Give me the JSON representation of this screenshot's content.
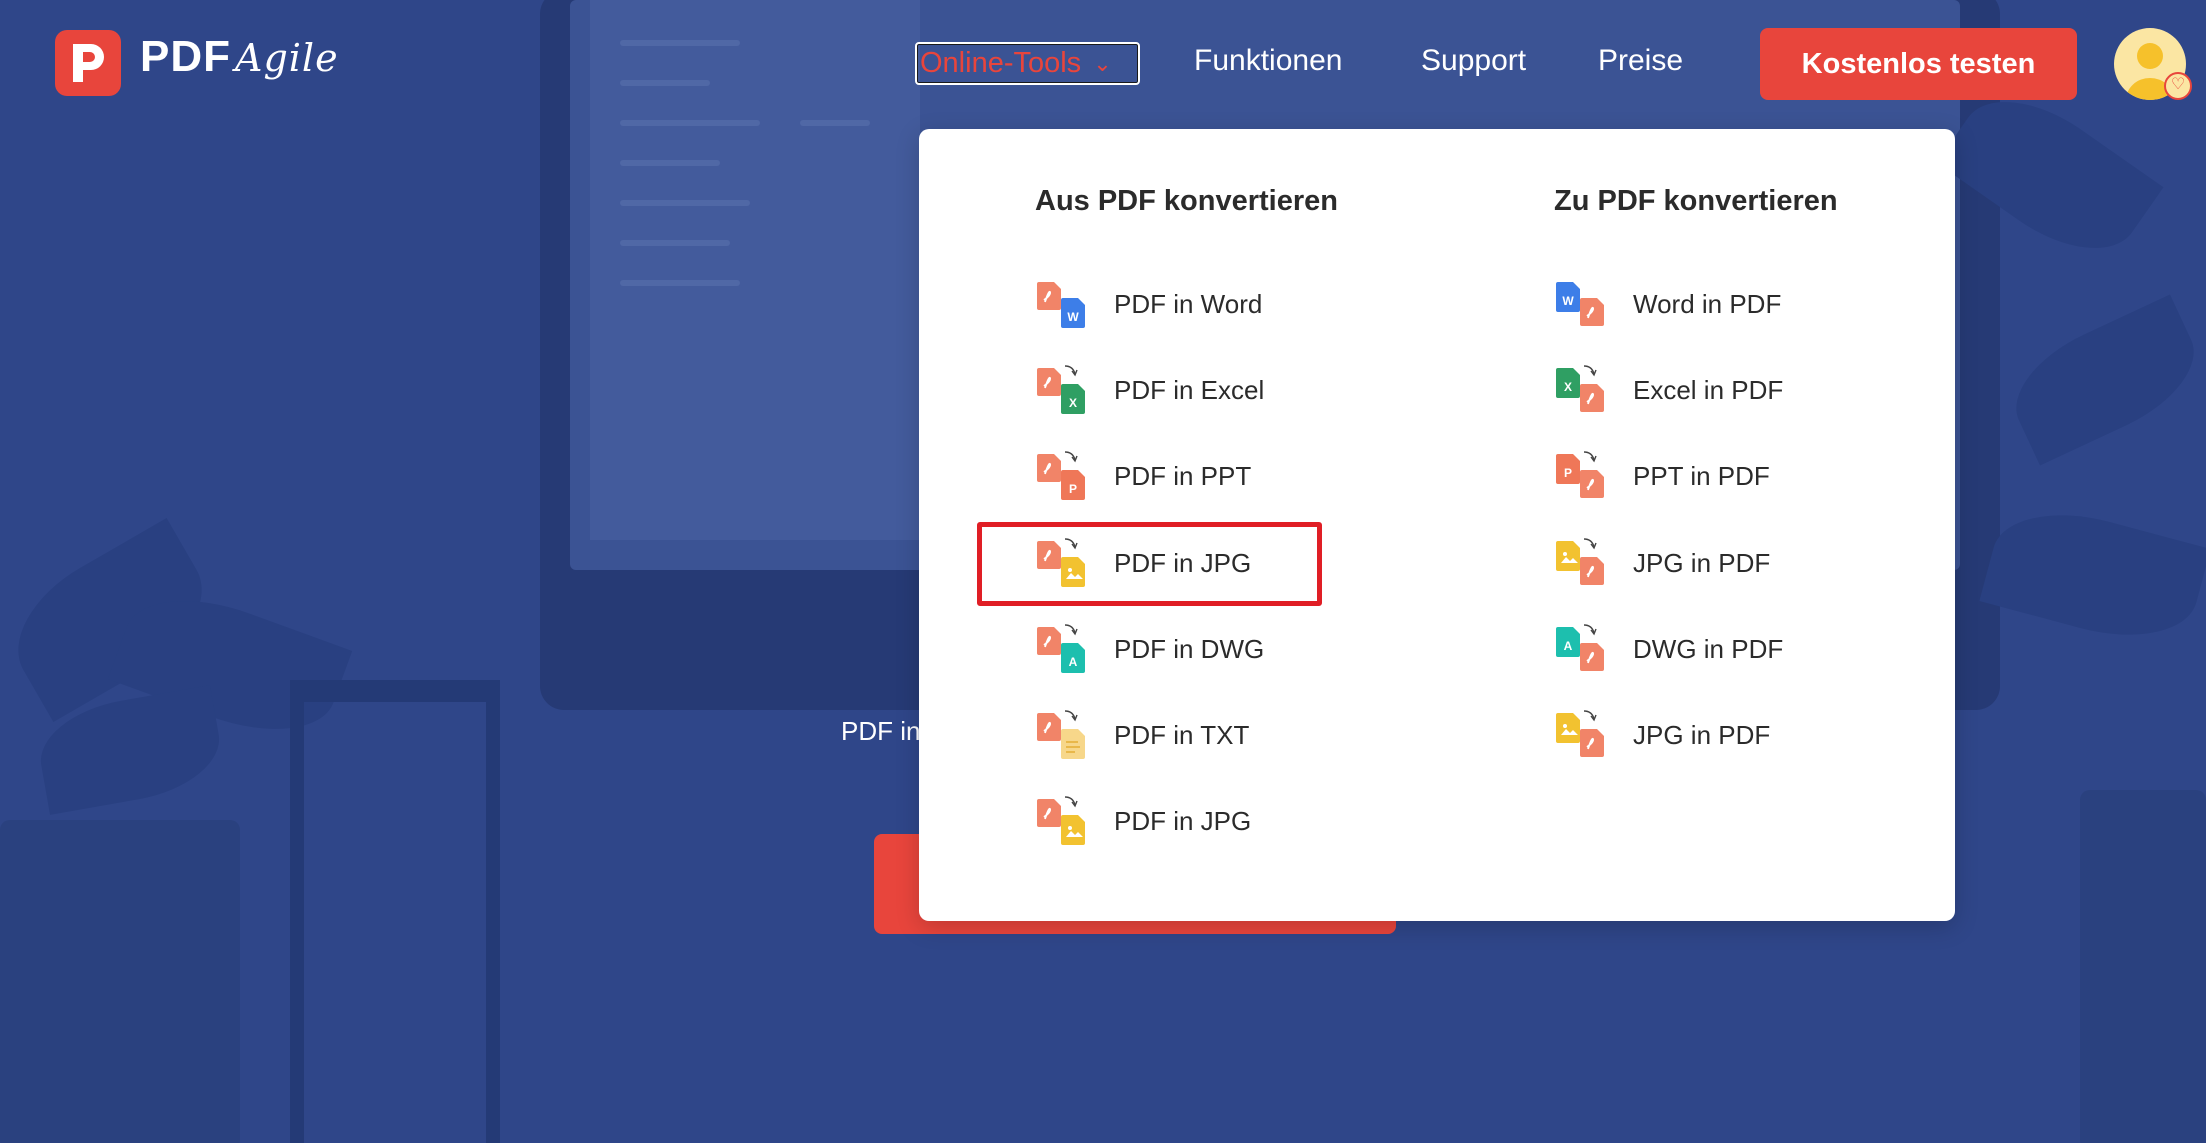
{
  "logo": {
    "brand": "PDF",
    "script": "Agile"
  },
  "nav": {
    "online_tools": "Online-Tools",
    "features": "Funktionen",
    "support": "Support",
    "pricing": "Preise",
    "cta": "Kostenlos testen"
  },
  "hero": {
    "text_visible": "PDF in"
  },
  "dropdown": {
    "left_title": "Aus PDF konvertieren",
    "right_title": "Zu PDF konvertieren",
    "left_items": [
      {
        "label": "PDF in Word",
        "icon": "pdf-to-word-icon"
      },
      {
        "label": "PDF in Excel",
        "icon": "pdf-to-excel-icon"
      },
      {
        "label": "PDF in PPT",
        "icon": "pdf-to-ppt-icon"
      },
      {
        "label": "PDF in JPG",
        "icon": "pdf-to-jpg-icon"
      },
      {
        "label": "PDF in DWG",
        "icon": "pdf-to-dwg-icon"
      },
      {
        "label": "PDF in TXT",
        "icon": "pdf-to-txt-icon"
      },
      {
        "label": "PDF in JPG",
        "icon": "pdf-to-jpg-icon"
      }
    ],
    "right_items": [
      {
        "label": "Word in PDF",
        "icon": "word-to-pdf-icon"
      },
      {
        "label": "Excel in PDF",
        "icon": "excel-to-pdf-icon"
      },
      {
        "label": "PPT in PDF",
        "icon": "ppt-to-pdf-icon"
      },
      {
        "label": "JPG in PDF",
        "icon": "jpg-to-pdf-icon"
      },
      {
        "label": "DWG in PDF",
        "icon": "dwg-to-pdf-icon"
      },
      {
        "label": "JPG in PDF",
        "icon": "jpg-to-pdf-icon"
      }
    ]
  },
  "colors": {
    "brand": "#e8453c",
    "background": "#2f4689",
    "highlight": "#e01e25",
    "word": "#3d7ee8",
    "excel": "#2f9f63",
    "ppt": "#ef7758",
    "jpg": "#f2c230",
    "dwg": "#1dbfae",
    "txt": "#f7d78a"
  }
}
